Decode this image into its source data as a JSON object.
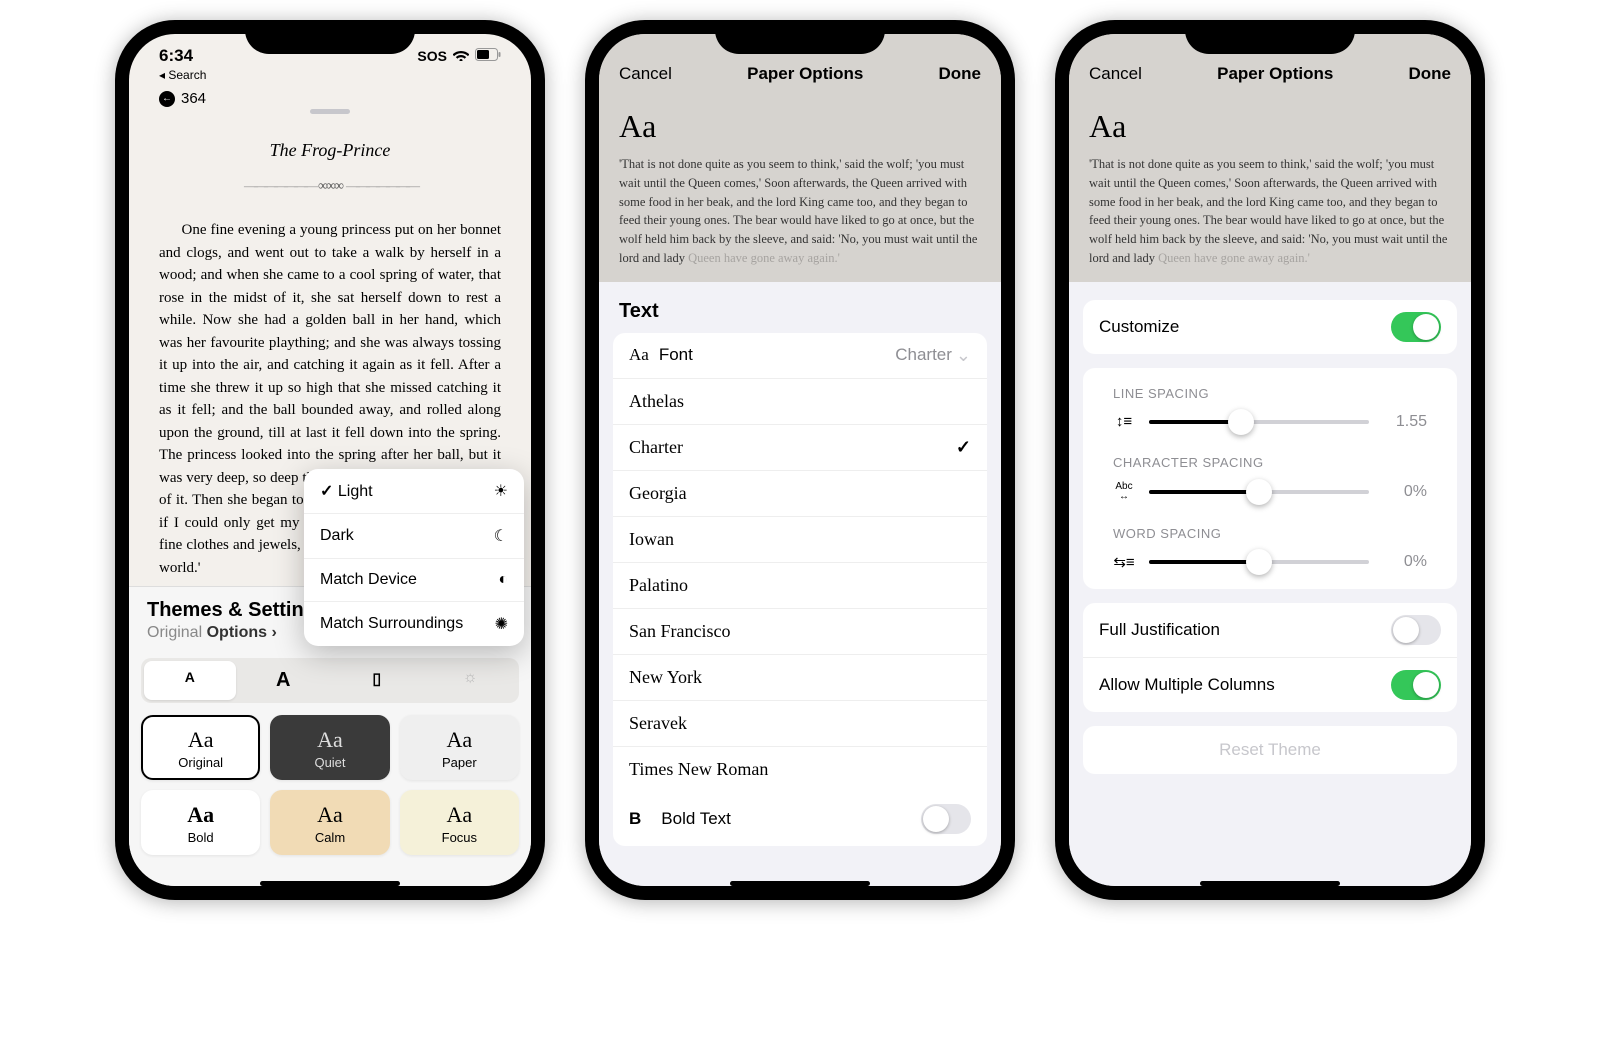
{
  "phone1": {
    "status": {
      "time": "6:34",
      "sos": "SOS"
    },
    "back_label": "Search",
    "page_number": "364",
    "chapter_title": "The Frog-Prince",
    "body_text": "One fine evening a young princess put on her bonnet and clogs, and went out to take a walk by herself in a wood; and when she came to a cool spring of water, that rose in the midst of it, she sat herself down to rest a while. Now she had a golden ball in her hand, which was her favourite plaything; and she was always tossing it up into the air, and catching it again as it fell. After a time she threw it up so high that she missed catching it as it fell; and the ball bounded away, and rolled along upon the ground, till at last it fell down into the spring. The princess looked into the spring after her ball, but it was very deep, so deep that she could not see the bottom of it. Then she began to bewail her loss, and said, 'Alas! if I could only get my ball again, I would give all my fine clothes and jewels, and everything that I have in the world.'",
    "sheet": {
      "title": "Themes & Settings",
      "sub_original": "Original",
      "sub_options": "Options",
      "themes": {
        "original": "Original",
        "quiet": "Quiet",
        "paper": "Paper",
        "bold": "Bold",
        "calm": "Calm",
        "focus": "Focus"
      }
    },
    "popup": {
      "light": "Light",
      "dark": "Dark",
      "match_device": "Match Device",
      "match_surroundings": "Match Surroundings"
    }
  },
  "phone2": {
    "header": {
      "cancel": "Cancel",
      "title": "Paper Options",
      "done": "Done"
    },
    "preview_aa": "Aa",
    "preview_text": "'That is not done quite as you seem to think,' said the wolf; 'you must wait until the Queen comes,' Soon afterwards, the Queen arrived with some food in her beak, and the lord King came too, and they began to feed their young ones. The bear would have liked to go at once, but the wolf held him back by the sleeve, and said: 'No, you must wait until the lord and lady ",
    "preview_fade": "Queen have gone away again.'",
    "section_label": "Text",
    "font_label": "Font",
    "font_value": "Charter",
    "fonts": [
      "Athelas",
      "Charter",
      "Georgia",
      "Iowan",
      "Palatino",
      "San Francisco",
      "New York",
      "Seravek",
      "Times New Roman"
    ],
    "selected_font": "Charter",
    "bold_label": "Bold Text"
  },
  "phone3": {
    "header": {
      "cancel": "Cancel",
      "title": "Paper Options",
      "done": "Done"
    },
    "preview_aa": "Aa",
    "preview_text": "'That is not done quite as you seem to think,' said the wolf; 'you must wait until the Queen comes,' Soon afterwards, the Queen arrived with some food in her beak, and the lord King came too, and they began to feed their young ones. The bear would have liked to go at once, but the wolf held him back by the sleeve, and said: 'No, you must wait until the lord and lady ",
    "preview_fade": "Queen have gone away again.'",
    "customize_label": "Customize",
    "line_spacing_label": "LINE SPACING",
    "line_spacing_value": "1.55",
    "char_spacing_label": "CHARACTER SPACING",
    "char_spacing_value": "0%",
    "word_spacing_label": "WORD SPACING",
    "word_spacing_value": "0%",
    "full_just_label": "Full Justification",
    "multi_col_label": "Allow Multiple Columns",
    "reset_label": "Reset Theme"
  }
}
